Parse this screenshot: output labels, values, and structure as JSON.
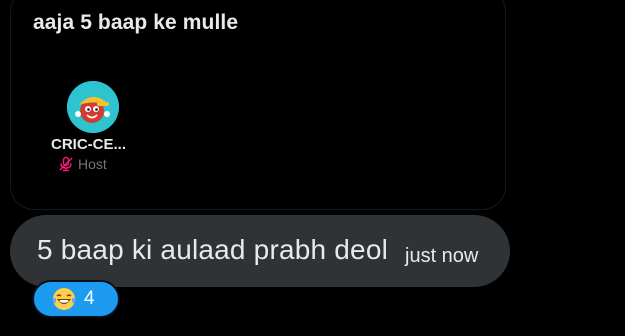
{
  "space": {
    "title": "aaja 5 baap ke mulle",
    "participant": {
      "name": "CRIC-CE...",
      "role": "Host",
      "avatar_icon": "cartoon-avatar-icon",
      "mic_icon": "mic-muted-icon",
      "mic_color": "#f91880",
      "avatar_bg": "#2ec4cf"
    }
  },
  "message": {
    "text": "5 baap ki aulaad prabh deol",
    "time": "just now"
  },
  "reaction": {
    "emoji_icon": "laughing-tears-emoji-icon",
    "count": "4",
    "color": "#1d9bf0"
  }
}
